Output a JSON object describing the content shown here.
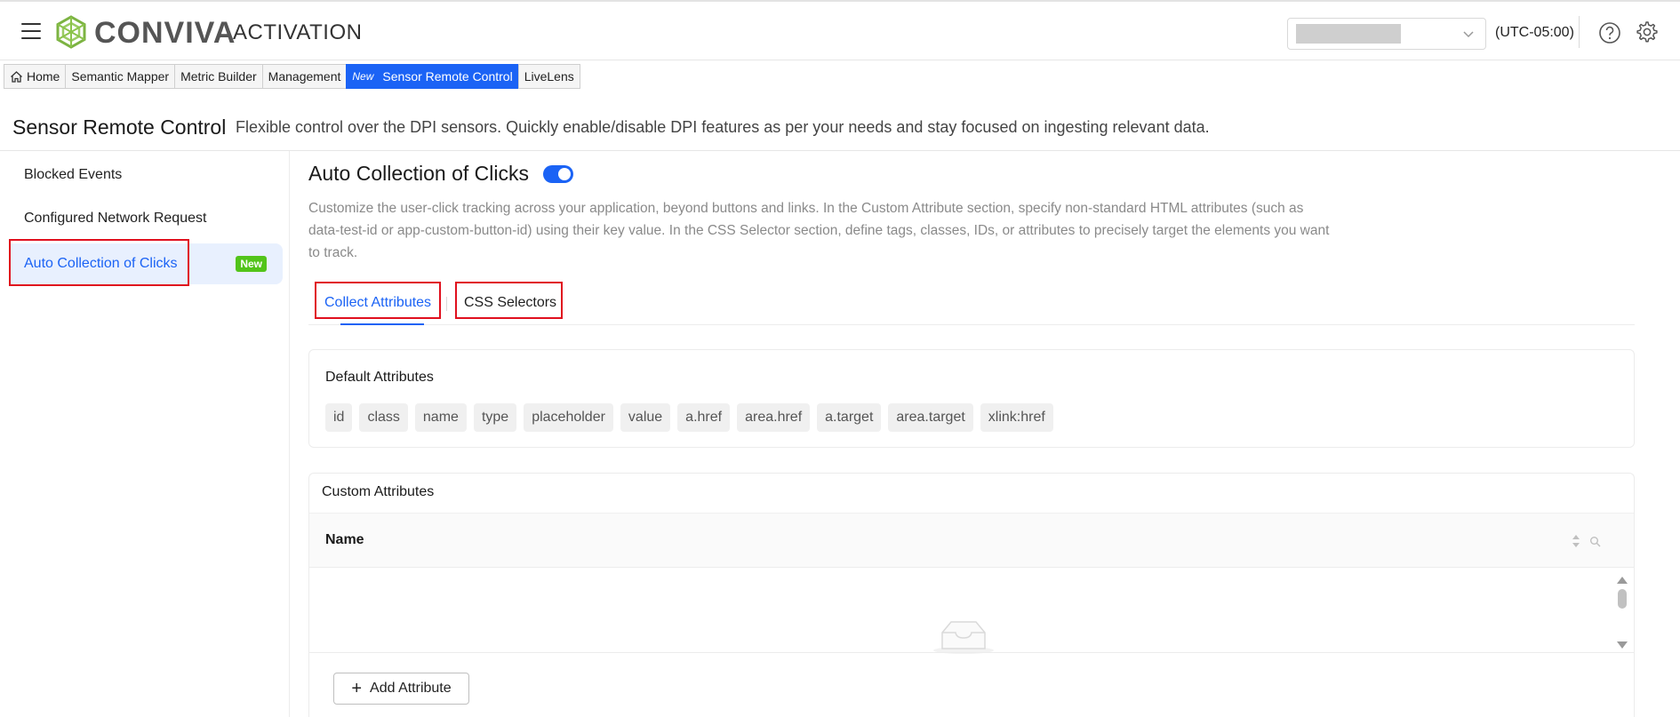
{
  "header": {
    "brand": "CONVIVA",
    "product": "ACTIVATION",
    "timezone": "(UTC-05:00)"
  },
  "nav": {
    "items": [
      {
        "label": "Home"
      },
      {
        "label": "Semantic Mapper"
      },
      {
        "label": "Metric Builder"
      },
      {
        "label": "Management"
      },
      {
        "label": "Sensor Remote Control",
        "badge": "New"
      },
      {
        "label": "LiveLens"
      }
    ]
  },
  "page": {
    "title": "Sensor Remote Control",
    "description": "Flexible control over the DPI sensors. Quickly enable/disable DPI features as per your needs and stay focused on ingesting relevant data."
  },
  "sidebar": {
    "items": [
      {
        "label": "Blocked Events"
      },
      {
        "label": "Configured Network Request"
      },
      {
        "label": "Auto Collection of Clicks",
        "badge": "New"
      }
    ]
  },
  "main": {
    "title": "Auto Collection of Clicks",
    "toggle_on": true,
    "description": "Customize the user-click tracking across your application, beyond buttons and links. In the Custom Attribute section, specify non-standard HTML attributes (such as data-test-id or app-custom-button-id) using their key value. In the CSS Selector section, define tags, classes, IDs, or attributes to precisely target the elements you want to track.",
    "tabs": [
      {
        "label": "Collect Attributes"
      },
      {
        "label": "CSS Selectors"
      }
    ],
    "default_attributes": {
      "title": "Default Attributes",
      "chips": [
        "id",
        "class",
        "name",
        "type",
        "placeholder",
        "value",
        "a.href",
        "area.href",
        "a.target",
        "area.target",
        "xlink:href"
      ]
    },
    "custom_attributes": {
      "title": "Custom Attributes",
      "column_name": "Name",
      "add_label": "Add Attribute"
    }
  },
  "colors": {
    "accent": "#1b63f5",
    "badge_green": "#52c41a",
    "highlight_red": "#e0101e"
  }
}
